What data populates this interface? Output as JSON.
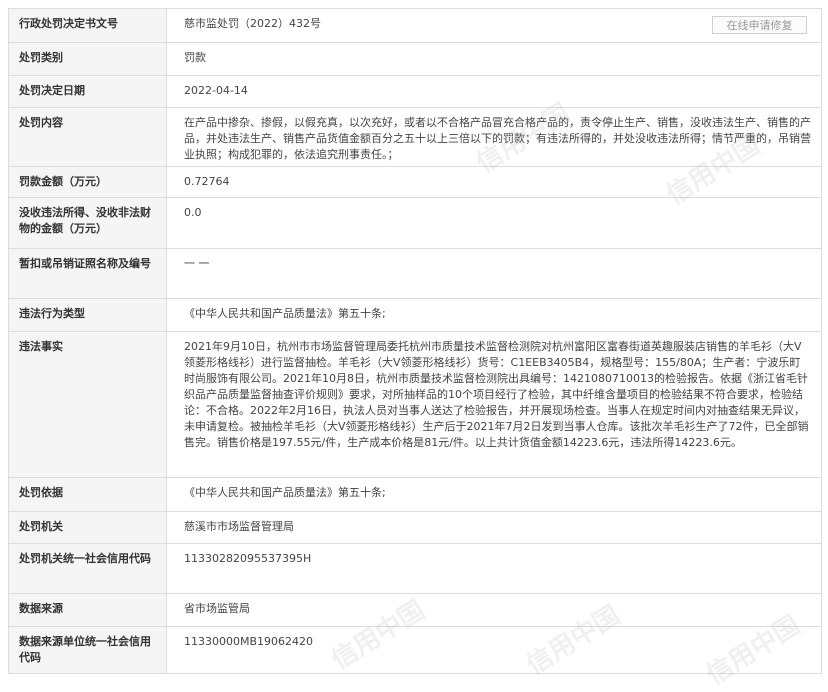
{
  "rows": [
    {
      "label": "行政处罚决定书文号",
      "value": "慈市监处罚（2022）432号",
      "height": 34
    },
    {
      "label": "处罚类别",
      "value": "罚款",
      "height": 33
    },
    {
      "label": "处罚决定日期",
      "value": "2022-04-14",
      "height": 32
    },
    {
      "label": "处罚内容",
      "value": "在产品中掺杂、掺假，以假充真，以次充好，或者以不合格产品冒充合格产品的，责令停止生产、销售，没收违法生产、销售的产品，并处违法生产、销售产品货值金额百分之五十以上三倍以下的罚款；有违法所得的，并处没收违法所得；情节严重的，吊销营业执照；构成犯罪的，依法追究刑事责任。；",
      "height": 59
    },
    {
      "label": "罚款金额（万元）",
      "value": "0.72764",
      "height": 31
    },
    {
      "label": "没收违法所得、没收非法财物的金额（万元）",
      "value": "0.0",
      "height": 51
    },
    {
      "label": "暂扣或吊销证照名称及编号",
      "value": "一 一",
      "height": 50
    },
    {
      "label": "违法行为类型",
      "value": "《中华人民共和国产品质量法》第五十条;",
      "height": 33
    },
    {
      "label": "违法事实",
      "value": "2021年9月10日，杭州市市场监督管理局委托杭州市质量技术监督检测院对杭州富阳区富春街道英趣服装店销售的羊毛衫（大V领菱形格线衫）进行监督抽检。羊毛衫（大V领菱形格线衫）货号：C1EEB3405B4，规格型号：155/80A；生产者：宁波乐町时尚服饰有限公司。2021年10月8日，杭州市质量技术监督检测院出具编号：1421080710013的检验报告。依据《浙江省毛针织品产品质量监督抽查评价规则》要求，对所抽样品的10个项目经行了检验，其中纤维含量项目的检验结果不符合要求，检验结论：不合格。2022年2月16日，执法人员对当事人送达了检验报告，并开展现场检查。当事人在规定时间内对抽查结果无异议，未申请复检。被抽检羊毛衫（大V领菱形格线衫）生产后于2021年7月2日发到当事人仓库。该批次羊毛衫生产了72件，已全部销售完。销售价格是197.55元/件，生产成本价格是81元/件。以上共计货值金额14223.6元，违法所得14223.6元。",
      "height": 146
    },
    {
      "label": "处罚依据",
      "value": "《中华人民共和国产品质量法》第五十条;",
      "height": 34
    },
    {
      "label": "处罚机关",
      "value": "慈溪市市场监督管理局",
      "height": 32
    },
    {
      "label": "处罚机关统一社会信用代码",
      "value": "11330282095537395H",
      "height": 50
    },
    {
      "label": "数据来源",
      "value": "省市场监管局",
      "height": 33
    },
    {
      "label": "数据来源单位统一社会信用代码",
      "value": "11330000MB19062420",
      "height": 47
    }
  ],
  "repair_button": "在线申请修复",
  "watermark": "信用中国",
  "colors": {
    "border": "#dcdcdc",
    "label_bg": "#f5f5f5",
    "text": "#444444",
    "button_text": "#999999"
  }
}
